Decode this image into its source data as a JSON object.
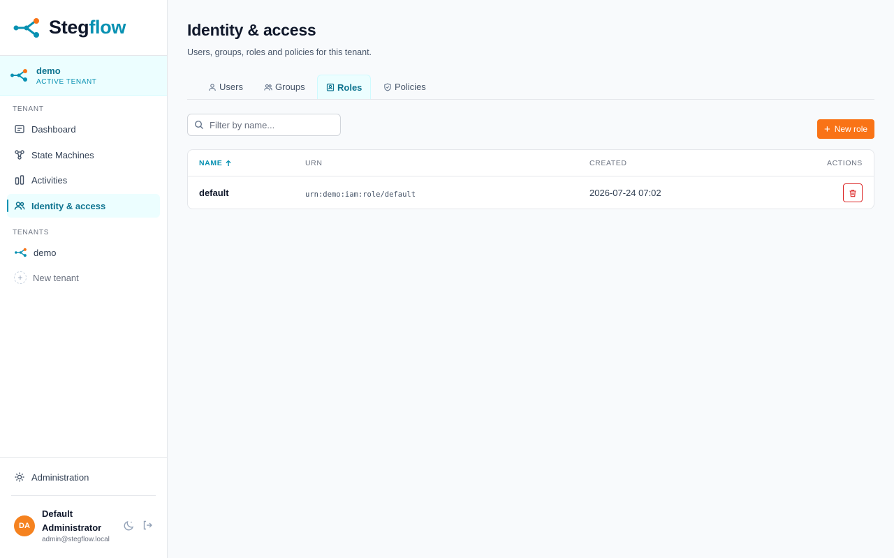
{
  "brand": {
    "name_part1": "Steg",
    "name_part2": "flow"
  },
  "active_tenant": {
    "name": "demo",
    "label": "ACTIVE TENANT"
  },
  "sidebar": {
    "tenant_section": "TENANT",
    "nav": [
      {
        "label": "Dashboard",
        "icon": "dashboard-icon"
      },
      {
        "label": "State Machines",
        "icon": "state-machines-icon"
      },
      {
        "label": "Activities",
        "icon": "activities-icon"
      },
      {
        "label": "Identity & access",
        "icon": "users-icon",
        "active": true
      }
    ],
    "tenants_section": "TENANTS",
    "tenants": [
      {
        "label": "demo",
        "icon": "tenant-icon"
      }
    ],
    "new_tenant_label": "New tenant",
    "administration_label": "Administration"
  },
  "user": {
    "initials": "DA",
    "name": "Default Administrator",
    "email": "admin@stegflow.local",
    "avatar_color": "#f5821f"
  },
  "page": {
    "title": "Identity & access",
    "subtitle": "Users, groups, roles and policies for this tenant."
  },
  "tabs": [
    {
      "label": "Users",
      "icon": "user-icon"
    },
    {
      "label": "Groups",
      "icon": "groups-icon"
    },
    {
      "label": "Roles",
      "icon": "role-badge-icon",
      "active": true
    },
    {
      "label": "Policies",
      "icon": "shield-icon"
    }
  ],
  "search": {
    "placeholder": "Filter by name..."
  },
  "new_role_label": "New role",
  "table": {
    "columns": {
      "name": "NAME",
      "urn": "URN",
      "created": "CREATED",
      "actions": "ACTIONS"
    },
    "sort": {
      "column": "name",
      "direction": "asc"
    },
    "rows": [
      {
        "name": "default",
        "urn": "urn:demo:iam:role/default",
        "created": "2026-07-24 07:02"
      }
    ]
  },
  "colors": {
    "accent": "#0891b2",
    "accent_bg": "#ecfeff",
    "primary_button": "#f97316",
    "danger": "#dc2626"
  }
}
